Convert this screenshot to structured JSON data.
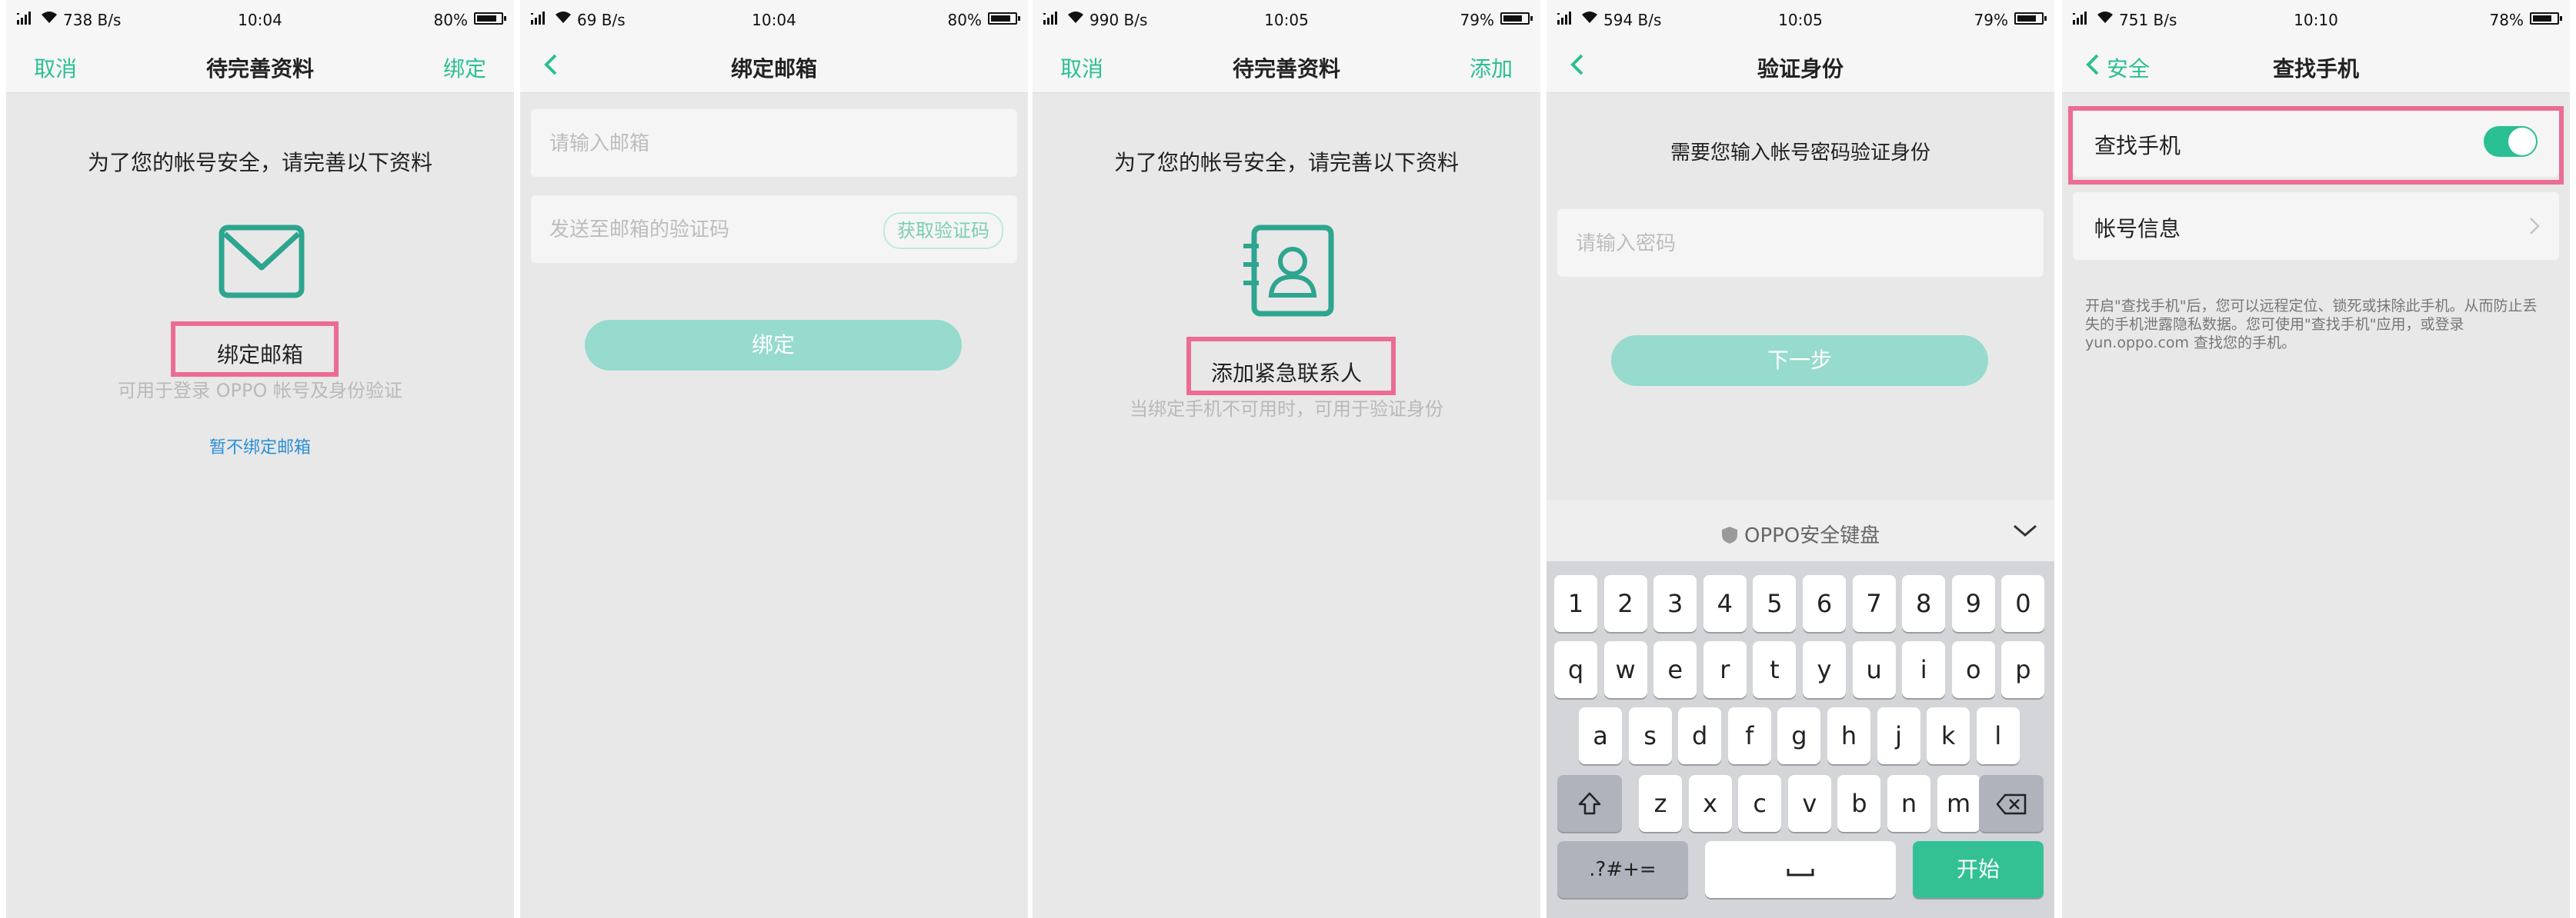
{
  "colors": {
    "accent": "#2bbf94",
    "highlight": "#ec6c93",
    "button_disabled": "#96dbcd",
    "page_bg": "#e8e8e8"
  },
  "screens": [
    {
      "status": {
        "speed": "738 B/s",
        "time": "10:04",
        "battery": "80%",
        "battery_level": 0.8
      },
      "nav": {
        "left": "取消",
        "title": "待完善资料",
        "right": "绑定"
      },
      "prompt": "为了您的帐号安全，请完善以下资料",
      "icon": "envelope-icon",
      "action_label": "绑定邮箱",
      "hint": "可用于登录 OPPO 帐号及身份验证",
      "skip_link": "暂不绑定邮箱"
    },
    {
      "status": {
        "speed": "69 B/s",
        "time": "10:04",
        "battery": "80%",
        "battery_level": 0.8
      },
      "nav": {
        "title": "绑定邮箱"
      },
      "email_placeholder": "请输入邮箱",
      "code_placeholder": "发送至邮箱的验证码",
      "get_code": "获取验证码",
      "submit": "绑定"
    },
    {
      "status": {
        "speed": "990 B/s",
        "time": "10:05",
        "battery": "79%",
        "battery_level": 0.79
      },
      "nav": {
        "left": "取消",
        "title": "待完善资料",
        "right": "添加"
      },
      "prompt": "为了您的帐号安全，请完善以下资料",
      "icon": "contact-book-icon",
      "action_label": "添加紧急联系人",
      "hint": "当绑定手机不可用时，可用于验证身份"
    },
    {
      "status": {
        "speed": "594 B/s",
        "time": "10:05",
        "battery": "79%",
        "battery_level": 0.79
      },
      "nav": {
        "title": "验证身份"
      },
      "prompt": "需要您输入帐号密码验证身份",
      "password_placeholder": "请输入密码",
      "next": "下一步",
      "keyboard": {
        "title": "OPPO安全键盘",
        "row1": [
          "1",
          "2",
          "3",
          "4",
          "5",
          "6",
          "7",
          "8",
          "9",
          "0"
        ],
        "row2": [
          "q",
          "w",
          "e",
          "r",
          "t",
          "y",
          "u",
          "i",
          "o",
          "p"
        ],
        "row3": [
          "a",
          "s",
          "d",
          "f",
          "g",
          "h",
          "j",
          "k",
          "l"
        ],
        "row4": [
          "z",
          "x",
          "c",
          "v",
          "b",
          "n",
          "m"
        ],
        "symbols": ".?#+=",
        "enter": "开始"
      }
    },
    {
      "status": {
        "speed": "751 B/s",
        "time": "10:10",
        "battery": "78%",
        "battery_level": 0.78
      },
      "nav": {
        "back_label": "安全",
        "title": "查找手机"
      },
      "find_phone": "查找手机",
      "find_phone_on": true,
      "account_info": "帐号信息",
      "description": "开启\"查找手机\"后，您可以远程定位、锁死或抹除此手机。从而防止丢失的手机泄露隐私数据。您可使用\"查找手机\"应用，或登录 yun.oppo.com 查找您的手机。"
    }
  ]
}
